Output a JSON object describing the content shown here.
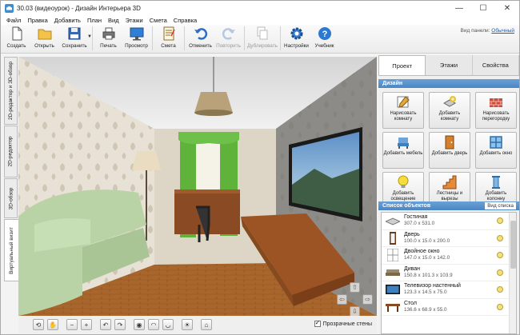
{
  "window": {
    "title": "30.03 (видеоурок) - Дизайн Интерьера 3D",
    "minimize": "—",
    "maximize": "☐",
    "close": "✕"
  },
  "menu": [
    "Файл",
    "Правка",
    "Добавить",
    "План",
    "Вид",
    "Этажи",
    "Смета",
    "Справка"
  ],
  "toolbar": {
    "create": "Создать",
    "open": "Открыть",
    "save": "Сохранить",
    "print": "Печать",
    "preview": "Просмотр",
    "estimate": "Смета",
    "undo": "Отменить",
    "redo": "Повторить",
    "duplicate": "Дублировать",
    "settings": "Настройки",
    "tutorial": "Учебник"
  },
  "view_panel": {
    "label": "Вид панели:",
    "value": "Обычный"
  },
  "side_tabs": [
    "2D-редактор и 3D-обзор",
    "2D-редактор",
    "3D-обзор",
    "Виртуальный визит"
  ],
  "bottom": {
    "transparent_walls": "Прозрачные стены"
  },
  "right_tabs": [
    "Проект",
    "Этажи",
    "Свойства"
  ],
  "design": {
    "header": "Дизайн",
    "buttons": [
      {
        "label": "Нарисовать комнату",
        "icon": "draw-room-icon"
      },
      {
        "label": "Добавить комнату",
        "icon": "add-room-icon"
      },
      {
        "label": "Нарисовать перегородку",
        "icon": "wall-icon"
      },
      {
        "label": "Добавить мебель",
        "icon": "furniture-icon"
      },
      {
        "label": "Добавить дверь",
        "icon": "door-icon"
      },
      {
        "label": "Добавить окно",
        "icon": "window-icon"
      },
      {
        "label": "Добавить освещение",
        "icon": "lamp-icon"
      },
      {
        "label": "Лестницы и вырезы",
        "icon": "stairs-icon"
      },
      {
        "label": "Добавить колонну",
        "icon": "column-icon"
      }
    ]
  },
  "objects": {
    "header": "Список объектов",
    "view_list": "Вид списка",
    "items": [
      {
        "name": "Гостиная",
        "dims": "307.0 x 531.0"
      },
      {
        "name": "Дверь",
        "dims": "100.0 x 15.0 x 200.0"
      },
      {
        "name": "Двойное окно",
        "dims": "147.0 x 15.0 x 142.0"
      },
      {
        "name": "Диван",
        "dims": "150.8 x 101.3 x 103.9"
      },
      {
        "name": "Телевизор настенный",
        "dims": "123.3 x 14.5 x 75.0"
      },
      {
        "name": "Стол",
        "dims": "136.6 x 68.9 x 55.0"
      }
    ]
  }
}
